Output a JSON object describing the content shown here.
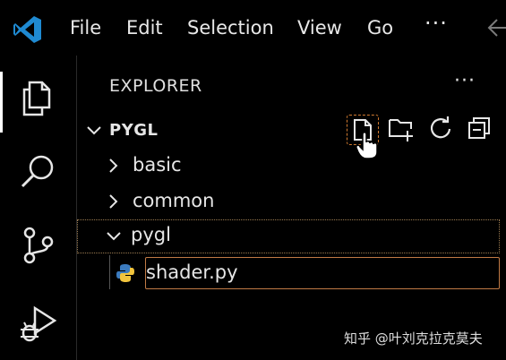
{
  "menu": {
    "items": [
      {
        "label": "File"
      },
      {
        "label": "Edit"
      },
      {
        "label": "Selection"
      },
      {
        "label": "View"
      },
      {
        "label": "Go"
      }
    ],
    "more": "···"
  },
  "sidebar": {
    "title": "EXPLORER",
    "more": "···",
    "section": "PYGL",
    "tree": [
      {
        "label": "basic",
        "type": "folder",
        "expanded": false
      },
      {
        "label": "common",
        "type": "folder",
        "expanded": false
      },
      {
        "label": "pygl",
        "type": "folder",
        "expanded": true
      },
      {
        "label": "shader.py",
        "type": "file",
        "selected": true
      }
    ]
  },
  "toolbar": {
    "new_file": "new-file-icon",
    "new_folder": "new-folder-icon",
    "refresh": "refresh-icon",
    "collapse_all": "collapse-all-icon"
  },
  "activity": [
    "explorer-icon",
    "search-icon",
    "source-control-icon",
    "run-debug-icon"
  ],
  "watermark": "知乎 @叶刘克拉克莫夫",
  "colors": {
    "accent_blue": "#1f8ad2",
    "selection_border": "#c07a45",
    "python_blue": "#3b7bbf",
    "python_yellow": "#f2c53d"
  }
}
